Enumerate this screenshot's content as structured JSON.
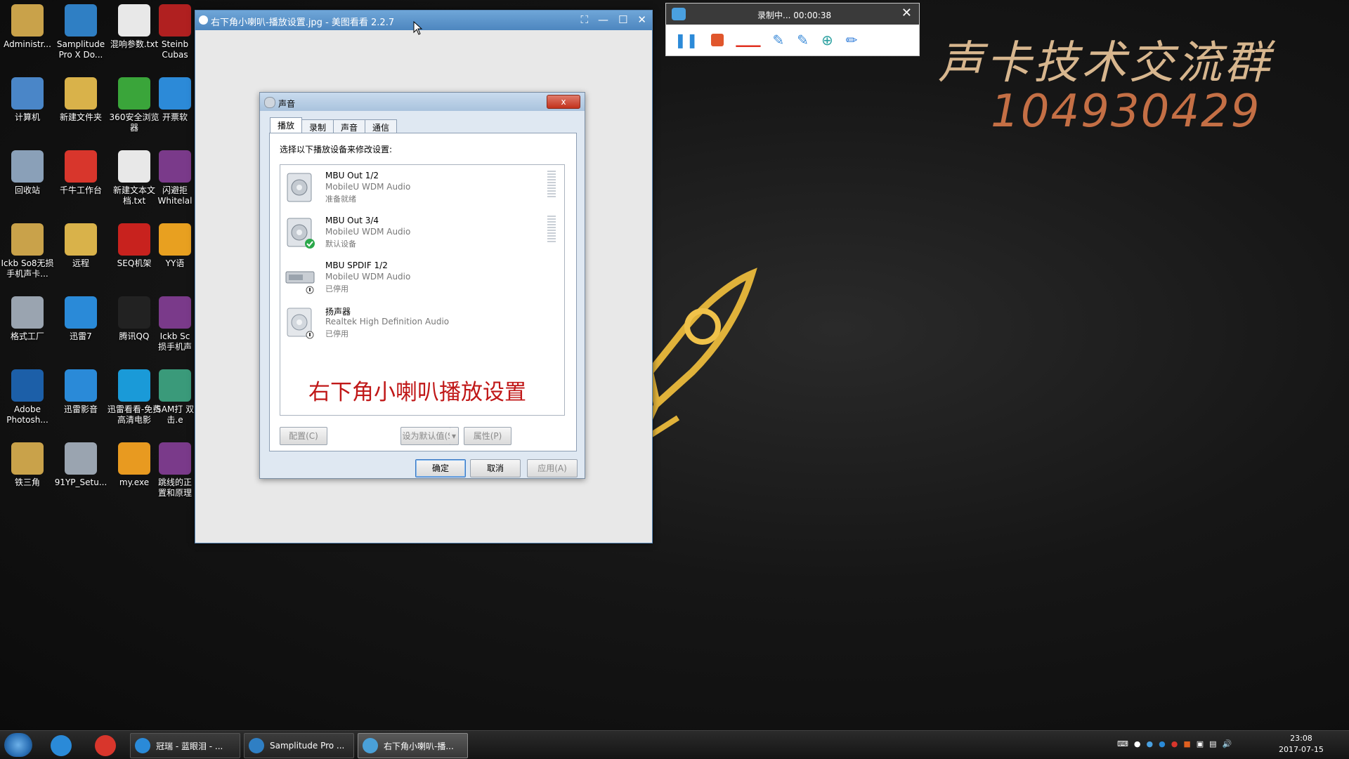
{
  "desktop_icons": [
    {
      "label": "Administr...",
      "icon": "folder-user-icon",
      "color": "#c9a24a"
    },
    {
      "label": "Samplitude Pro X Do...",
      "icon": "samplitude-icon",
      "color": "#2f7fc4"
    },
    {
      "label": "混响参数.txt",
      "icon": "text-file-icon",
      "color": "#e8e8e8"
    },
    {
      "label": "Steinb Cubas",
      "icon": "cubase-icon",
      "color": "#b02020"
    },
    {
      "label": "计算机",
      "icon": "computer-icon",
      "color": "#4a86c8"
    },
    {
      "label": "新建文件夹",
      "icon": "folder-icon",
      "color": "#d9b24a"
    },
    {
      "label": "360安全浏览器",
      "icon": "browser-360-icon",
      "color": "#3aa53a"
    },
    {
      "label": "开票软",
      "icon": "ie-icon",
      "color": "#2c8ad8"
    },
    {
      "label": "回收站",
      "icon": "recycle-bin-icon",
      "color": "#8aa0b8"
    },
    {
      "label": "千牛工作台",
      "icon": "qianniu-icon",
      "color": "#d8362c"
    },
    {
      "label": "新建文本文档.txt",
      "icon": "text-file-icon",
      "color": "#e8e8e8"
    },
    {
      "label": "闪避拒 Whitelal",
      "icon": "archive-icon",
      "color": "#7a3a8a"
    },
    {
      "label": "Ickb So8无损手机声卡...",
      "icon": "folder-user-icon",
      "color": "#c9a24a"
    },
    {
      "label": "远程",
      "icon": "folder-icon",
      "color": "#d9b24a"
    },
    {
      "label": "SEQ机架",
      "icon": "seq-icon",
      "color": "#c8221e"
    },
    {
      "label": "YY语",
      "icon": "yy-icon",
      "color": "#e8a020"
    },
    {
      "label": "格式工厂",
      "icon": "format-factory-icon",
      "color": "#9aa4b0"
    },
    {
      "label": "迅雷7",
      "icon": "xunlei-icon",
      "color": "#2a8ad8"
    },
    {
      "label": "腾讯QQ",
      "icon": "qq-icon",
      "color": "#222222"
    },
    {
      "label": "Ickb Sc 损手机声",
      "icon": "archive-icon",
      "color": "#7a3a8a"
    },
    {
      "label": "Adobe Photosh...",
      "icon": "photoshop-icon",
      "color": "#1c5fa8"
    },
    {
      "label": "迅雷影音",
      "icon": "xunlei-player-icon",
      "color": "#2a8ad8"
    },
    {
      "label": "迅雷看看-免费高清电影",
      "icon": "xunlei-kankan-icon",
      "color": "#1a9ad8"
    },
    {
      "label": "SAM打 双击.e",
      "icon": "sam-icon",
      "color": "#3a9a7a"
    },
    {
      "label": "铁三角",
      "icon": "folder-user-icon",
      "color": "#c9a24a"
    },
    {
      "label": "91YP_Setu...",
      "icon": "installer-icon",
      "color": "#9aa4b0"
    },
    {
      "label": "my.exe",
      "icon": "dream-icon",
      "color": "#e89a20"
    },
    {
      "label": "跳线的正 置和原理",
      "icon": "archive-icon",
      "color": "#7a3a8a"
    }
  ],
  "branding": {
    "title": "声卡技术交流群",
    "number": "104930429"
  },
  "recorder": {
    "title": "录制中... 00:00:38",
    "tools": [
      "pause-icon",
      "stop-icon",
      "dashes-icon",
      "pen-tool-icon",
      "pen-tool-2-icon",
      "zoom-icon",
      "marker-icon"
    ]
  },
  "viewer": {
    "title": "右下角小喇叭-播放设置.jpg - 美图看看 2.2.7"
  },
  "sound_dialog": {
    "title": "声音",
    "close": "x",
    "tabs": [
      "播放",
      "录制",
      "声音",
      "通信"
    ],
    "hint": "选择以下播放设备来修改设置:",
    "devices": [
      {
        "name": "MBU Out 1/2",
        "driver": "MobileU WDM Audio",
        "status": "准备就绪"
      },
      {
        "name": "MBU Out 3/4",
        "driver": "MobileU WDM Audio",
        "status": "默认设备"
      },
      {
        "name": "MBU SPDIF 1/2",
        "driver": "MobileU WDM Audio",
        "status": "已停用"
      },
      {
        "name": "扬声器",
        "driver": "Realtek High Definition Audio",
        "status": "已停用"
      }
    ],
    "caption": "右下角小喇叭播放设置",
    "buttons": {
      "configure": "配置(C)",
      "set_default": "设为默认值(S)",
      "properties": "属性(P)",
      "ok": "确定",
      "cancel": "取消",
      "apply": "应用(A)"
    }
  },
  "taskbar": {
    "apps": [
      {
        "label": "冠瑞 - 蓝眼泪 - ...",
        "icon": "kugou-icon"
      },
      {
        "label": "Samplitude Pro ...",
        "icon": "samplitude-icon"
      },
      {
        "label": "右下角小喇叭-播...",
        "icon": "image-viewer-icon"
      }
    ],
    "time": "23:08",
    "date": "2017-07-15"
  }
}
